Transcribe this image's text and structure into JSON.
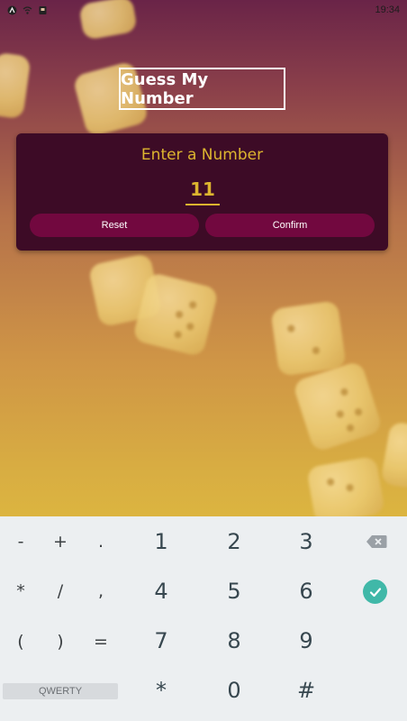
{
  "status_bar": {
    "time": "19:34"
  },
  "app": {
    "title": "Guess My Number",
    "card_heading": "Enter a Number",
    "input_value": "11",
    "reset_label": "Reset",
    "confirm_label": "Confirm"
  },
  "keyboard": {
    "rows": [
      [
        "-",
        "+",
        ".",
        "1",
        "2",
        "3"
      ],
      [
        "*",
        "/",
        ",",
        "4",
        "5",
        "6"
      ],
      [
        "(",
        ")",
        "=",
        "7",
        "8",
        "9"
      ],
      [
        "*",
        "0",
        "#"
      ]
    ],
    "qwerty_label": "QWERTY",
    "backspace_icon": "backspace-icon",
    "done_icon": "check-icon",
    "accent": "#40b8a8"
  },
  "colors": {
    "card": "#3d0b26",
    "accent_text": "#ddb52f",
    "button": "#72083f"
  }
}
